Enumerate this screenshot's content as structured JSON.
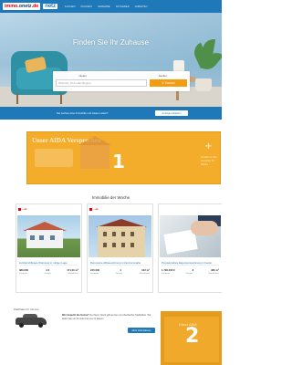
{
  "nav": {
    "logo_immo": "immo",
    "logo_dot": ".",
    "logo_onetz": "onetz",
    "logo_de": ".de",
    "netz": "netz",
    "items": [
      "Suchen",
      "Wohnen",
      "Gewerbe",
      "Ratgeber",
      "Anbieten"
    ]
  },
  "hero": {
    "title": "Finden Sie Ihr Zuhause",
    "toggle_mieten": "mieten",
    "toggle_kaufen": "kaufen",
    "search_placeholder": "Wohnort, PLZ oder Region",
    "search_button": "Suchen"
  },
  "blue_strip": {
    "text": "Sie suchen eine Immobilie und wissen wann?",
    "button": "Anzeige aufgeben"
  },
  "ad1": {
    "headline": "Unser AIDA Versprechen",
    "number": "1",
    "side_text": "Vorteile fur Ihre Immobilie Ihr Makler"
  },
  "featured": {
    "title": "Immobilie der Woche",
    "cards": [
      {
        "badge": "...ot",
        "title": "Lichtdurchflutete Wohnung in ruhiger Lage",
        "values": [
          "389.000",
          "4.5",
          "171,00 m²"
        ],
        "labels": [
          "Kaufpreis",
          "Zimmer",
          "Wohnflache"
        ]
      },
      {
        "badge": "...ot",
        "title": "Renovierte Altbauwohnung in Zentrumsnahe",
        "values": [
          "245.000",
          "4",
          "102 m²"
        ],
        "labels": [
          "Kaufpreis",
          "Zimmer",
          "Wohnflache"
        ]
      },
      {
        "badge": "",
        "title": "Provisionsfreie Eigentumswohnung in bester",
        "values": [
          "1.790.000 €",
          "8",
          "380 m²"
        ],
        "labels": [
          "Kaufpreis",
          "Zimmer",
          "Wohnflache"
        ]
      }
    ]
  },
  "lower": {
    "label": "Parkhaus fur mit uns",
    "text_bold": "Wer braucht die Sonne?",
    "text": "Zu Ihrem Glück gibt es bei uns überdachte Stellplätze. Wir laden Sie ein Ihr Auto bei uns zu lassen.",
    "button": "Mehr Informationen"
  },
  "ad2": {
    "text": "Unser AIDA",
    "number": "2"
  },
  "colors": {
    "brand_blue": "#1f78b8",
    "ad_orange": "#f3ad2a",
    "logo_red": "#e3000f"
  }
}
